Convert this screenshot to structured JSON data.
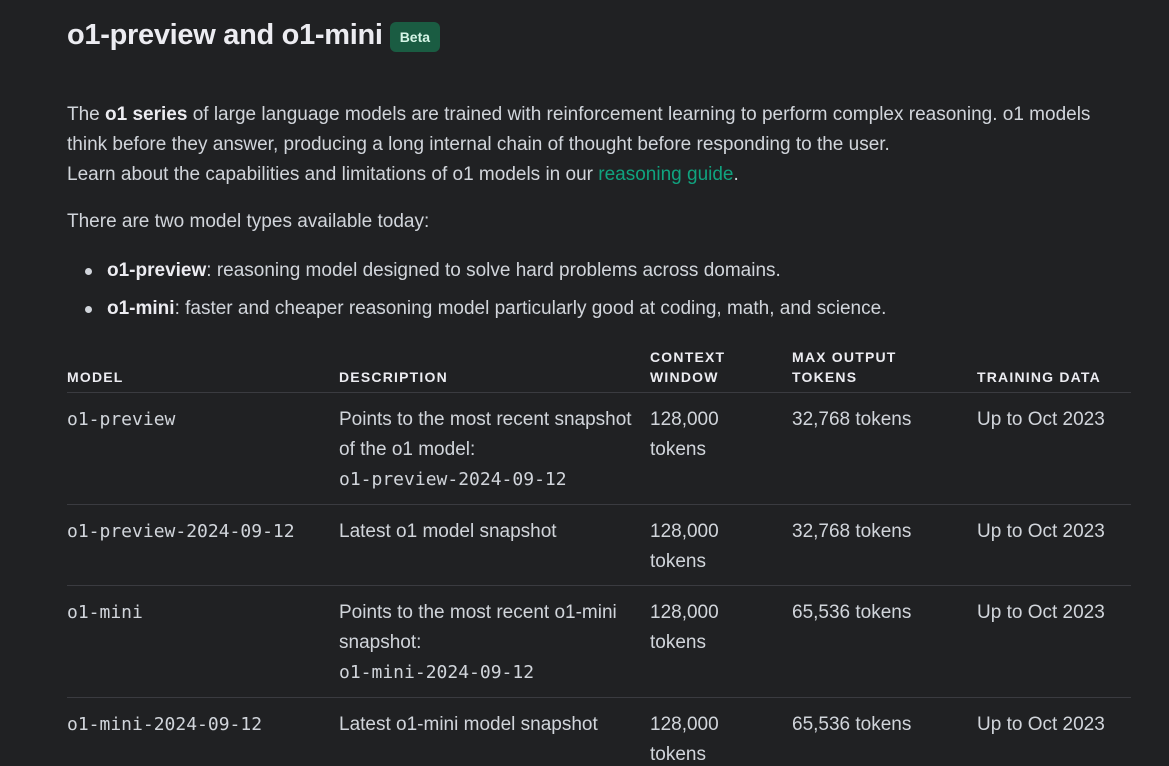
{
  "header": {
    "title": "o1-preview and o1-mini",
    "badge": "Beta"
  },
  "intro": {
    "p1_start": "The ",
    "p1_bold": "o1 series",
    "p1_rest": " of large language models are trained with reinforcement learning to perform complex reasoning. o1 models think before they answer, producing a long internal chain of thought before responding to the user.",
    "p2_start": "Learn about the capabilities and limitations of o1 models in our ",
    "p2_link": "reasoning guide",
    "p2_end": ".",
    "types_intro": "There are two model types available today:"
  },
  "bullets": [
    {
      "name": "o1-preview",
      "text": ": reasoning model designed to solve hard problems across domains."
    },
    {
      "name": "o1-mini",
      "text": ": faster and cheaper reasoning model particularly good at coding, math, and science."
    }
  ],
  "table": {
    "headers": {
      "model": "MODEL",
      "description": "DESCRIPTION",
      "context_line1": "CONTEXT",
      "context_line2": "WINDOW",
      "max_line1": "MAX OUTPUT",
      "max_line2": "TOKENS",
      "training": "TRAINING DATA"
    },
    "rows": [
      {
        "model": "o1-preview",
        "desc": "Points to the most recent snapshot of the o1 model:",
        "desc_code": "o1-preview-2024-09-12",
        "context": "128,000 tokens",
        "max": "32,768 tokens",
        "training": "Up to Oct 2023"
      },
      {
        "model": "o1-preview-2024-09-12",
        "desc": "Latest o1 model snapshot",
        "desc_code": "",
        "context": "128,000 tokens",
        "max": "32,768 tokens",
        "training": "Up to Oct 2023"
      },
      {
        "model": "o1-mini",
        "desc": "Points to the most recent o1-mini snapshot:",
        "desc_code": "o1-mini-2024-09-12",
        "context": "128,000 tokens",
        "max": "65,536 tokens",
        "training": "Up to Oct 2023"
      },
      {
        "model": "o1-mini-2024-09-12",
        "desc": "Latest o1-mini model snapshot",
        "desc_code": "",
        "context": "128,000 tokens",
        "max": "65,536 tokens",
        "training": "Up to Oct 2023"
      }
    ]
  }
}
